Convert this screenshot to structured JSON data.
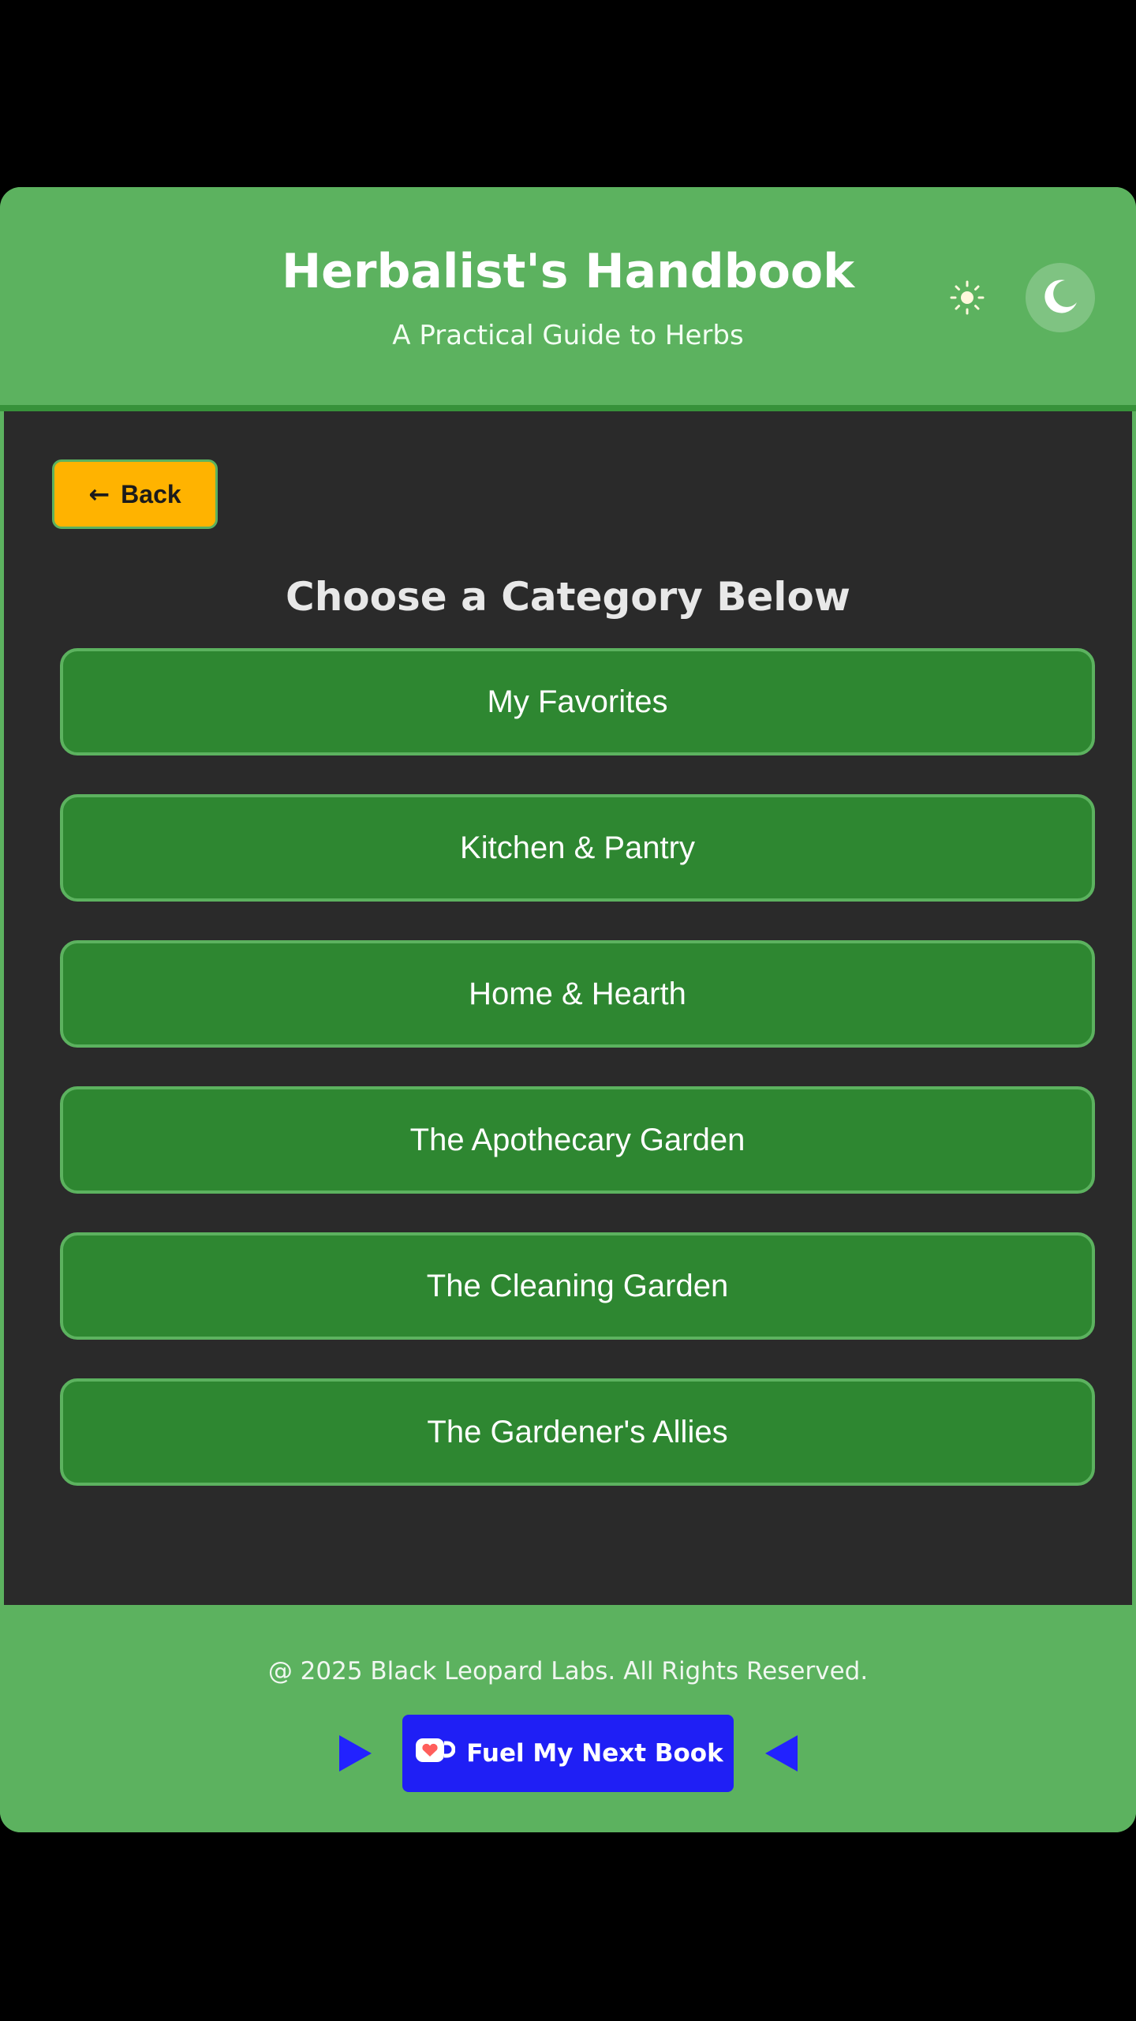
{
  "header": {
    "title": "Herbalist's Handbook",
    "subtitle": "A Practical Guide to Herbs",
    "light_mode_icon": "sun-icon",
    "dark_mode_icon": "moon-icon"
  },
  "main": {
    "back_arrow": "←",
    "back_label": "Back",
    "heading": "Choose a Category Below",
    "categories": [
      {
        "label": "My Favorites"
      },
      {
        "label": "Kitchen & Pantry"
      },
      {
        "label": "Home & Hearth"
      },
      {
        "label": "The Apothecary Garden"
      },
      {
        "label": "The Cleaning Garden"
      },
      {
        "label": "The Gardener's Allies"
      }
    ]
  },
  "footer": {
    "copyright": "@ 2025 Black Leopard Labs. All Rights Reserved.",
    "support_label": "Fuel My Next Book",
    "support_icon": "kofi-cup-icon"
  },
  "colors": {
    "brand_green": "#5cb25f",
    "category_green": "#2e8731",
    "panel_dark": "#2a2a2a",
    "back_yellow": "#ffb300",
    "support_blue": "#1f1ff5"
  }
}
